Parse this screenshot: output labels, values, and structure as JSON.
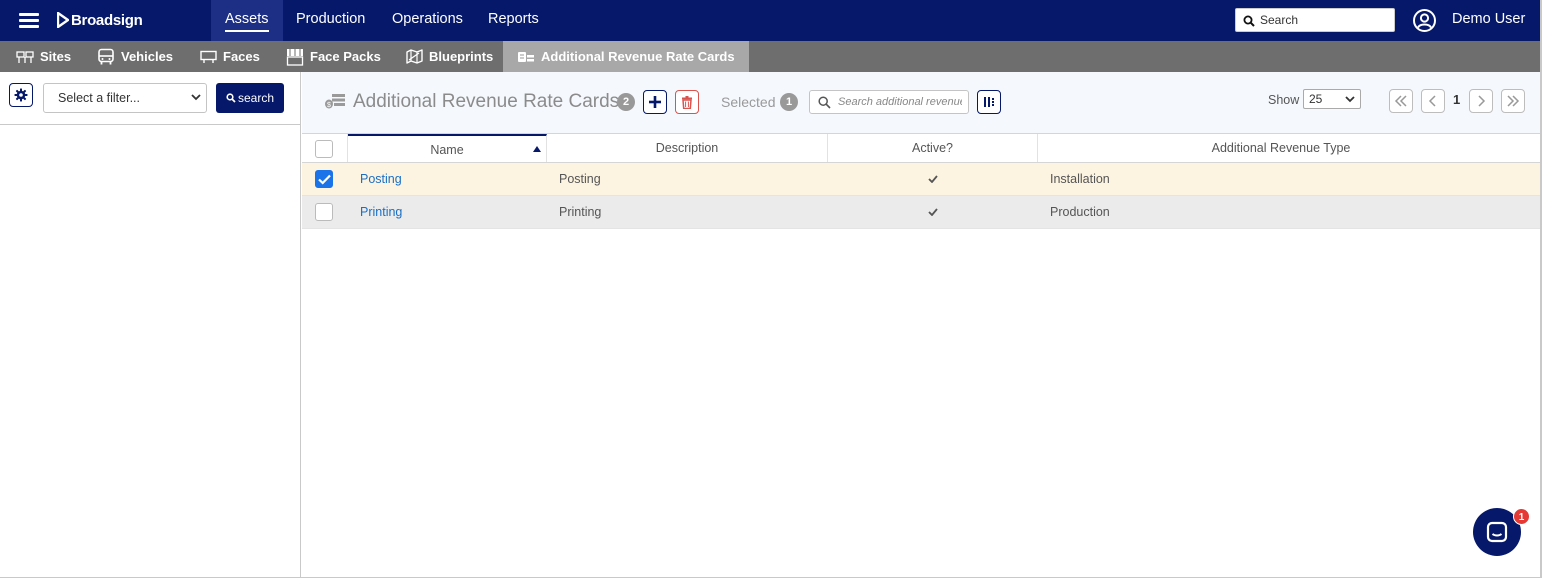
{
  "brand": {
    "name": "Broadsign"
  },
  "topnav": {
    "tabs": [
      {
        "label": "Assets",
        "active": true
      },
      {
        "label": "Production",
        "active": false
      },
      {
        "label": "Operations",
        "active": false
      },
      {
        "label": "Reports",
        "active": false
      }
    ],
    "search_placeholder": "Search",
    "user_name": "Demo User"
  },
  "subnav": {
    "tabs": [
      {
        "label": "Sites",
        "icon": "sites-icon"
      },
      {
        "label": "Vehicles",
        "icon": "bus-icon"
      },
      {
        "label": "Faces",
        "icon": "billboard-icon"
      },
      {
        "label": "Face Packs",
        "icon": "face-pack-icon"
      },
      {
        "label": "Blueprints",
        "icon": "blueprint-icon"
      },
      {
        "label": "Additional Revenue Rate Cards",
        "icon": "rate-card-icon",
        "active": true
      }
    ]
  },
  "filter": {
    "select_placeholder": "Select a filter...",
    "search_label": "search"
  },
  "header": {
    "title": "Additional Revenue Rate Cards",
    "count": "2",
    "selected_label": "Selected",
    "selected_count": "1",
    "search_placeholder": "Search additional revenue",
    "show_label": "Show",
    "page_size": "25",
    "current_page": "1"
  },
  "table": {
    "columns": [
      "Name",
      "Description",
      "Active?",
      "Additional Revenue Type"
    ],
    "rows": [
      {
        "name": "Posting",
        "description": "Posting",
        "active": true,
        "type": "Installation",
        "selected": true
      },
      {
        "name": "Printing",
        "description": "Printing",
        "active": true,
        "type": "Production",
        "selected": false
      }
    ]
  },
  "chat": {
    "badge": "1"
  },
  "colors": {
    "primary": "#06186a",
    "subnav": "#6e6e6e",
    "link": "#1a6fc4",
    "selected_row": "#fdf3e1",
    "danger": "#d9534f"
  }
}
